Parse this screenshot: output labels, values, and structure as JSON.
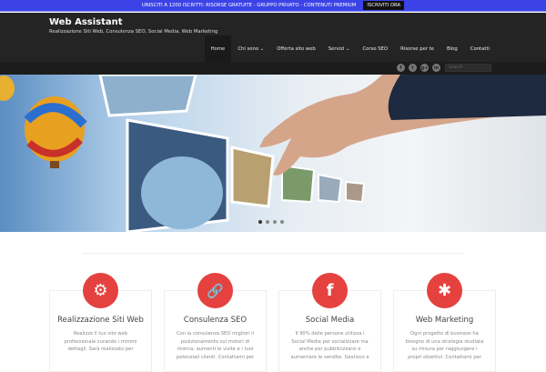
{
  "topbar": {
    "text": "UNISCITI A 1200 ISCRITTI: RISORSE GRATUITE - GRUPPO PRIVATO - CONTENUTI PREMIUM",
    "cta": "ISCRIVITI ORA",
    "color": "#3c43e6"
  },
  "header": {
    "title": "Web Assistant",
    "tagline": "Realizzazione Siti Web, Consulenza SEO, Social Media, Web Marketing"
  },
  "nav": [
    "Home",
    "Chi sono ⌄",
    "Offerta sito web",
    "Servizi ⌄",
    "Corso SEO",
    "Risorse per te",
    "Blog",
    "Contatti"
  ],
  "social": [
    {
      "icon": "facebook-icon",
      "glyph": "f"
    },
    {
      "icon": "twitter-icon",
      "glyph": "t"
    },
    {
      "icon": "google-plus-icon",
      "glyph": "g+"
    },
    {
      "icon": "linkedin-icon",
      "glyph": "in"
    }
  ],
  "search": {
    "placeholder": "Search"
  },
  "cards": [
    {
      "icon": "gear-icon",
      "glyph": "⚙",
      "title": "Realizzazione Siti Web",
      "text": "Realizzo il tuo sito web professionale curando i minimi dettagli. Sarà realizzato per"
    },
    {
      "icon": "link-icon",
      "glyph": "🔗",
      "title": "Consulenza SEO",
      "text": "Con la consulenza SEO migliori il posizionamento sui motori di ricerca, aumenti le visite e i tuoi potenziali clienti. Contattami per"
    },
    {
      "icon": "facebook-icon",
      "glyph": "f",
      "title": "Social Media",
      "text": "Il 90% delle persone utilizza i Social Media per socializzare ma anche per pubblicizzarsi e aumentare le vendite. Gestisco e"
    },
    {
      "icon": "asterisk-icon",
      "glyph": "✱",
      "title": "Web Marketing",
      "text": "Ogni progetto di business ha bisogno di una strategia studiata su misura per raggiungere i propri obiettivi. Contattami per"
    }
  ]
}
